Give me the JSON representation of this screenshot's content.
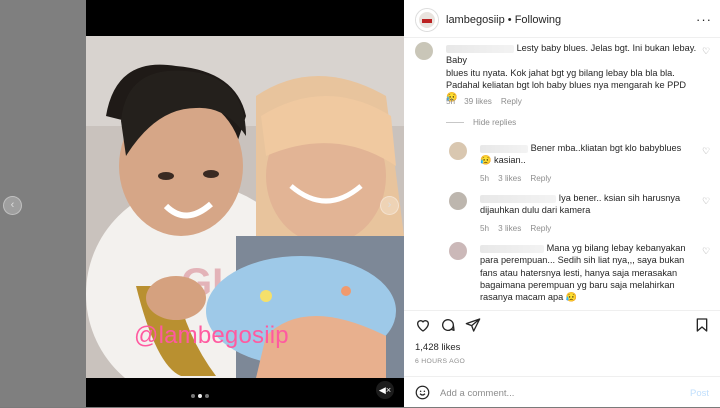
{
  "post": {
    "username": "lambegosiip",
    "separator": "•",
    "follow_status": "Following",
    "more_icon": "more-horizontal-icon"
  },
  "media": {
    "watermark": "@lambegosiip",
    "carousel_dots": 3,
    "active_dot": 1
  },
  "comments": [
    {
      "text_line1": "Lesty baby blues. Jelas bgt. Ini bukan lebay. Baby",
      "text_line2": "blues itu nyata. Kok jahat bgt yg bilang lebay bla bla bla.",
      "text_line3": "Padahal keliatan bgt loh baby blues nya mengarah ke PPD",
      "emoji": "😥",
      "time": "5h",
      "likes": "39 likes",
      "reply": "Reply",
      "hide_replies": "Hide replies"
    },
    {
      "text_line1": "Bener mba..kliatan bgt klo babyblues",
      "text_line2": "kasian..",
      "emoji": "😥",
      "time": "5h",
      "likes": "3 likes",
      "reply": "Reply"
    },
    {
      "text_line1": "Iya bener.. ksian sih harusnya",
      "text_line2": "dijauhkan dulu dari kamera",
      "time": "5h",
      "likes": "3 likes",
      "reply": "Reply"
    },
    {
      "text_line1": "Mana yg bilang lebay kebanyakan",
      "text_line2": "para perempuan... Sedih sih liat nya,,, saya bukan",
      "text_line3": "fans atau hatersnya lesti, hanya saja merasakan",
      "text_line4": "bagaimana perempuan yg baru saja melahirkan",
      "text_line5": "rasanya macam apa",
      "emoji": "😥",
      "time": "5h",
      "likes": "3 likes",
      "reply": "Reply"
    }
  ],
  "actions": {
    "likes": "1,428 likes",
    "time": "6 HOURS AGO"
  },
  "add_comment": {
    "placeholder": "Add a comment...",
    "post_label": "Post"
  },
  "colors": {
    "watermark": "#ff5aa0",
    "post_button": "#c0dffd",
    "muted": "#8e8e8e"
  }
}
